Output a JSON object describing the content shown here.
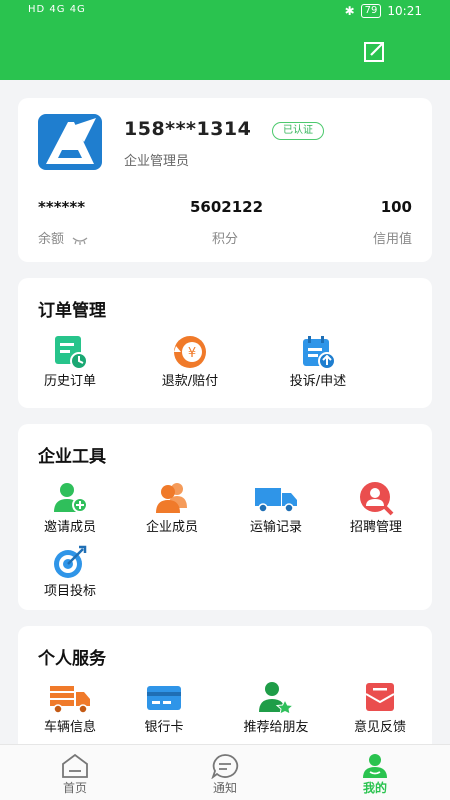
{
  "status_bar": {
    "left": "HD 4G 4G",
    "battery": "79",
    "time": "10:21"
  },
  "profile": {
    "phone": "158***1314",
    "verified_badge": "已认证",
    "role": "企业管理员",
    "stats": [
      {
        "value": "******",
        "label": "余额"
      },
      {
        "value": "5602122",
        "label": "积分"
      },
      {
        "value": "100",
        "label": "信用值"
      }
    ]
  },
  "order_management": {
    "title": "订单管理",
    "items": [
      {
        "label": "历史订单",
        "icon": "history-order-icon"
      },
      {
        "label": "退款/赔付",
        "icon": "refund-icon"
      },
      {
        "label": "投诉/申述",
        "icon": "complaint-icon"
      }
    ]
  },
  "enterprise_tools": {
    "title": "企业工具",
    "items": [
      {
        "label": "邀请成员",
        "icon": "invite-member-icon"
      },
      {
        "label": "企业成员",
        "icon": "members-icon"
      },
      {
        "label": "运输记录",
        "icon": "truck-icon"
      },
      {
        "label": "招聘管理",
        "icon": "recruit-icon"
      },
      {
        "label": "项目投标",
        "icon": "target-icon"
      }
    ]
  },
  "personal_services": {
    "title": "个人服务",
    "items": [
      {
        "label": "车辆信息",
        "icon": "vehicle-icon"
      },
      {
        "label": "银行卡",
        "icon": "bank-card-icon"
      },
      {
        "label": "推荐给朋友",
        "icon": "recommend-icon"
      },
      {
        "label": "意见反馈",
        "icon": "feedback-icon"
      }
    ]
  },
  "tabbar": {
    "tabs": [
      {
        "label": "首页",
        "icon": "home-icon"
      },
      {
        "label": "通知",
        "icon": "message-icon"
      },
      {
        "label": "我的",
        "icon": "profile-icon"
      }
    ],
    "active": "我的"
  },
  "colors": {
    "brand": "#2ac34f",
    "green_icon": "#2fbf5b",
    "orange_icon": "#f07a2a",
    "blue_icon": "#2f95e8",
    "red_icon": "#ea4e4e"
  }
}
